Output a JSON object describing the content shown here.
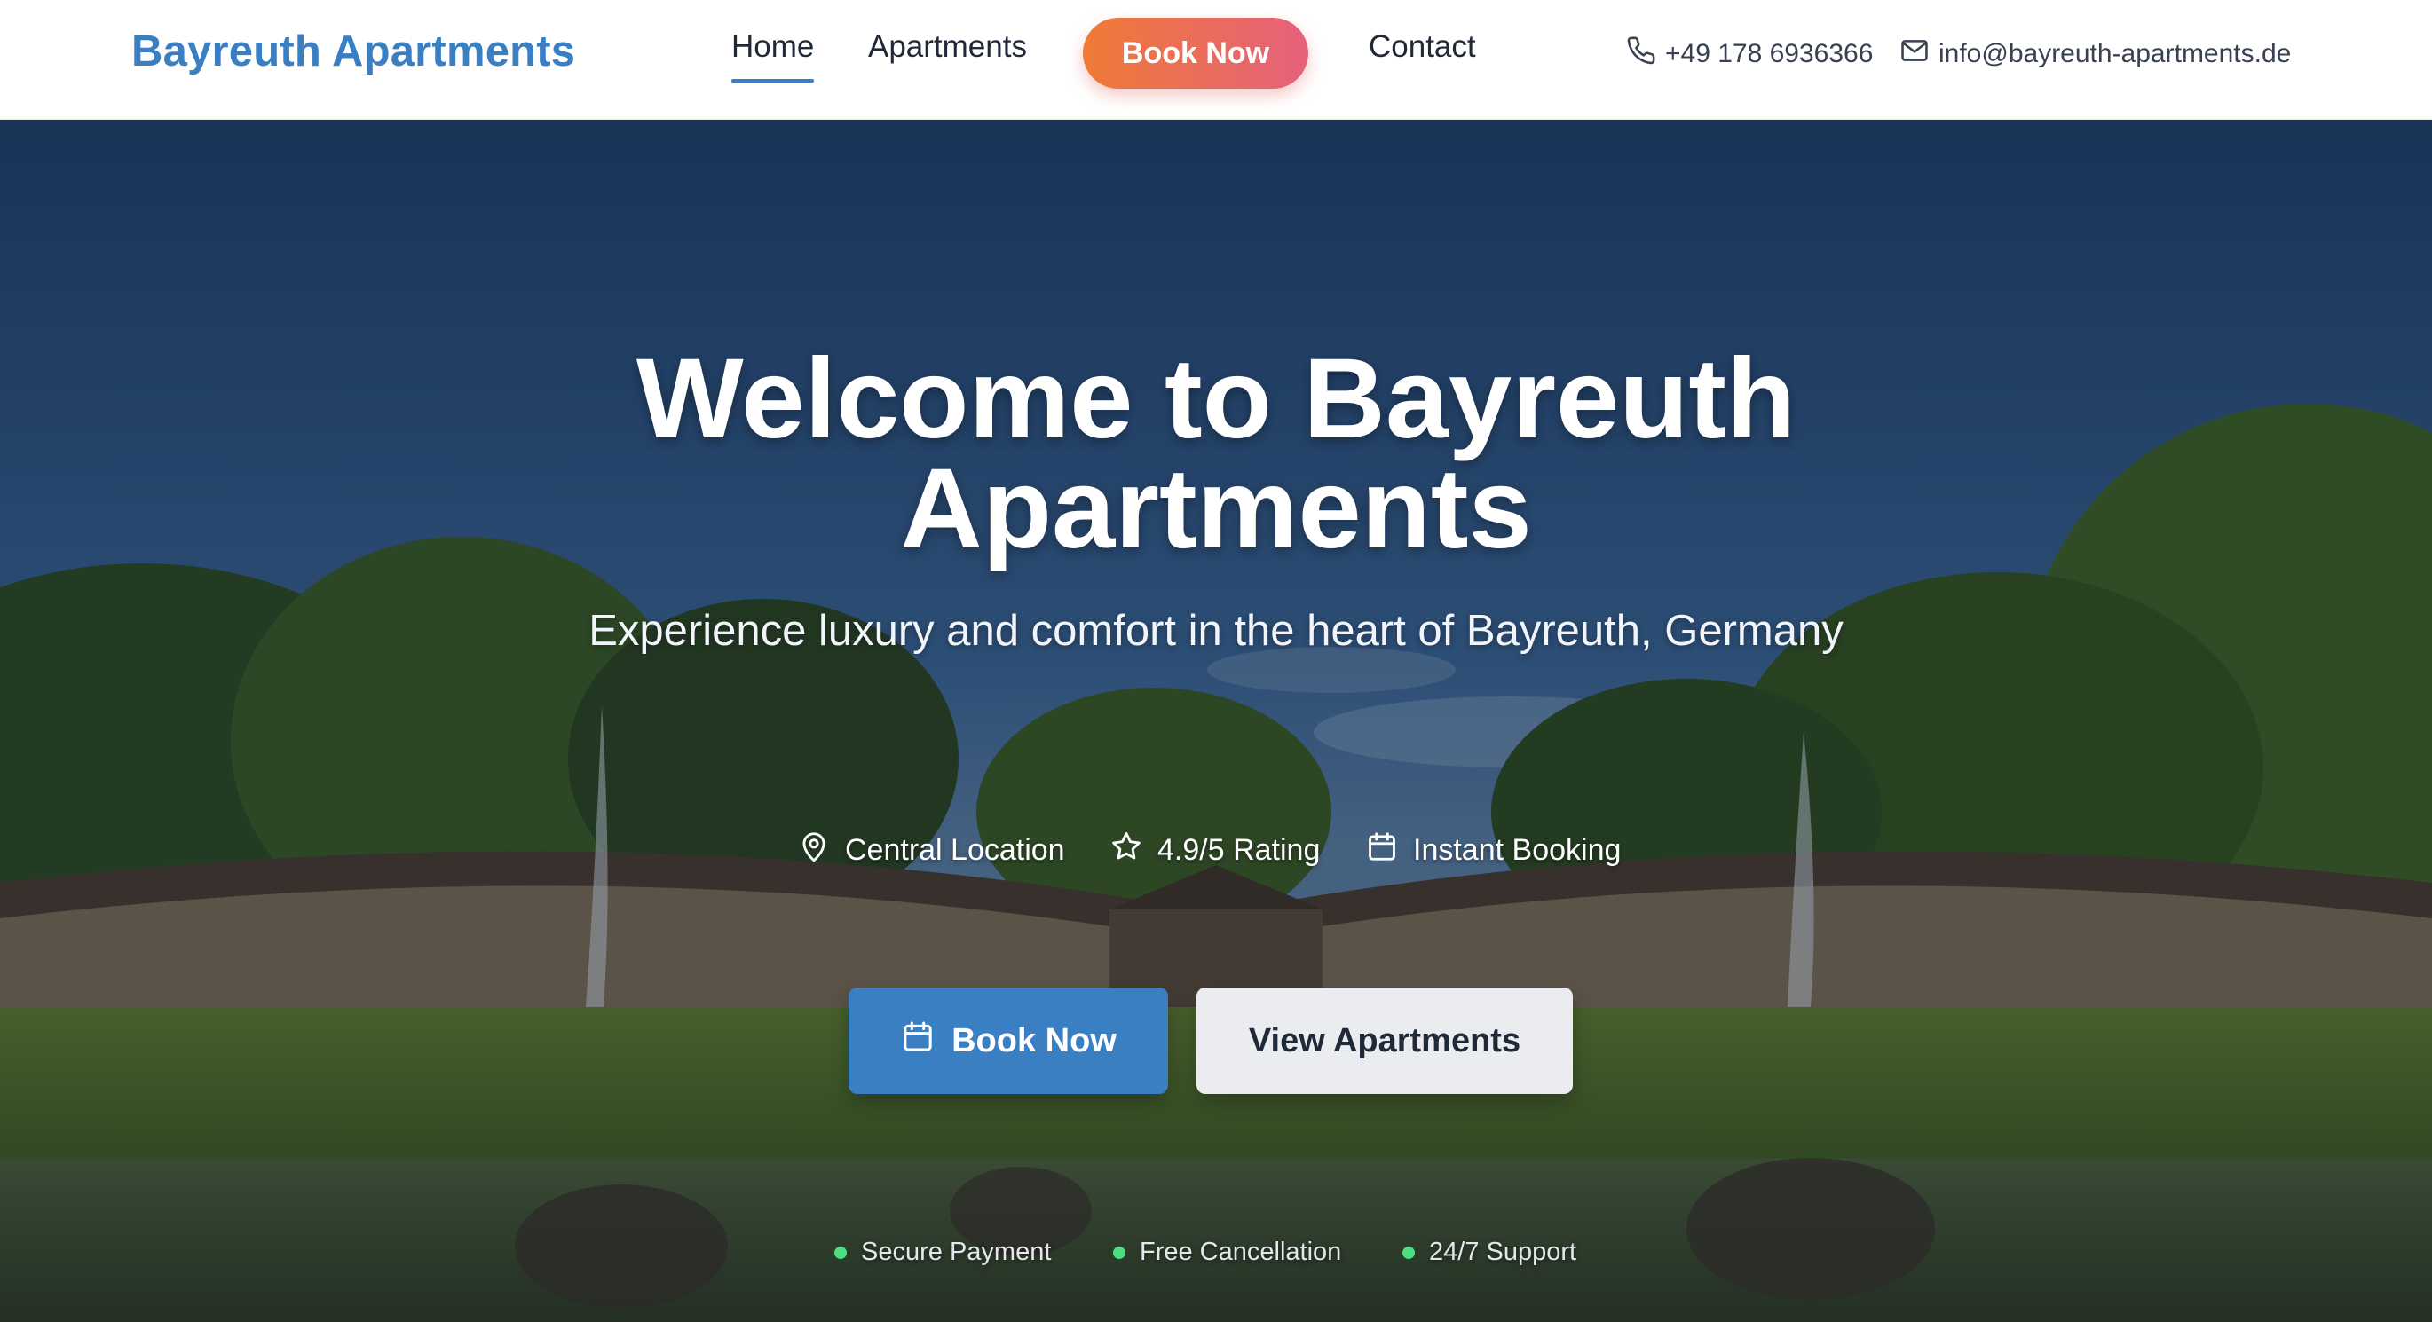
{
  "brand": {
    "name": "Bayreuth Apartments",
    "color": "#3b7fc3"
  },
  "nav": {
    "items": [
      {
        "label": "Home",
        "active": true
      },
      {
        "label": "Apartments",
        "active": false
      },
      {
        "label": "Contact",
        "active": false
      }
    ],
    "cta_label": "Book Now",
    "cta_gradient": [
      "#ef7a36",
      "#e6617d"
    ]
  },
  "contact": {
    "phone": "+49 178 6936366",
    "phone_icon": "phone-icon",
    "email": "info@bayreuth-apartments.de",
    "email_icon": "mail-icon"
  },
  "hero": {
    "title_line1": "Welcome to Bayreuth",
    "title_line2": "Apartments",
    "subtitle": "Experience luxury and comfort in the heart of Bayreuth, Germany",
    "features": [
      {
        "label": "Central Location",
        "icon": "map-pin-icon"
      },
      {
        "label": "4.9/5 Rating",
        "icon": "star-icon"
      },
      {
        "label": "Instant Booking",
        "icon": "calendar-icon"
      }
    ],
    "primary_button": {
      "label": "Book Now",
      "icon": "calendar-icon",
      "color": "#3b7fc3"
    },
    "secondary_button": {
      "label": "View Apartments"
    },
    "trust_badges": [
      {
        "label": "Secure Payment"
      },
      {
        "label": "Free Cancellation"
      },
      {
        "label": "24/7 Support"
      }
    ],
    "trust_dot_color": "#4ade80"
  }
}
